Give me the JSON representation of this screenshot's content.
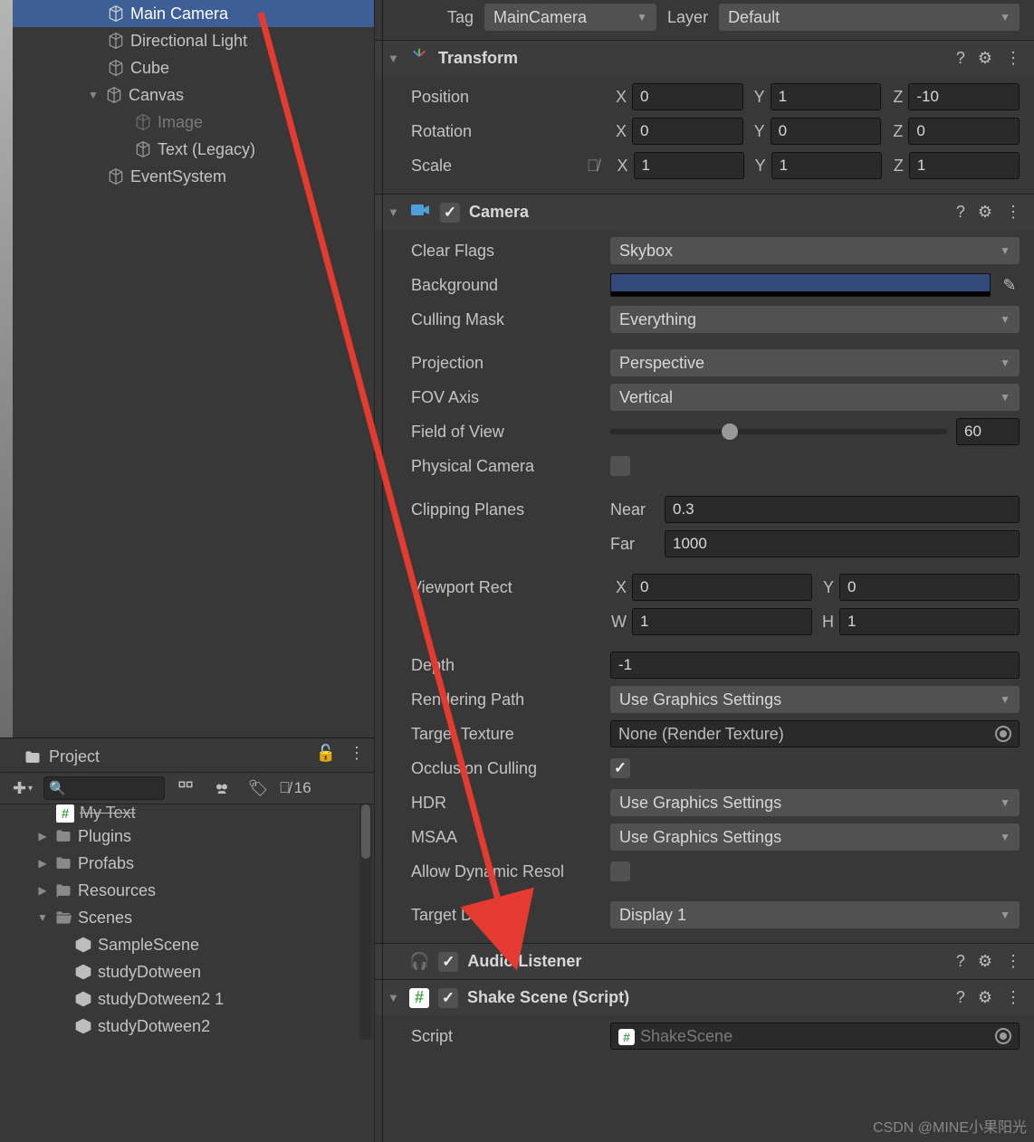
{
  "hierarchy": {
    "items": [
      {
        "label": "Main Camera",
        "indent": 1,
        "selected": true
      },
      {
        "label": "Directional Light",
        "indent": 1
      },
      {
        "label": "Cube",
        "indent": 1
      },
      {
        "label": "Canvas",
        "indent": 1,
        "fold": "down"
      },
      {
        "label": "Image",
        "indent": 2,
        "dimmed": true
      },
      {
        "label": "Text (Legacy)",
        "indent": 2
      },
      {
        "label": "EventSystem",
        "indent": 1
      }
    ]
  },
  "project": {
    "tab": "Project",
    "search_placeholder": "",
    "hidden_count": "16",
    "tree": [
      {
        "label": "My Text",
        "indent": 62,
        "type": "script-green",
        "clipped": true
      },
      {
        "label": "Plugins",
        "indent": 40,
        "type": "folder",
        "arrow": "right"
      },
      {
        "label": "Profabs",
        "indent": 40,
        "type": "folder",
        "arrow": "right"
      },
      {
        "label": "Resources",
        "indent": 40,
        "type": "folder",
        "arrow": "right"
      },
      {
        "label": "Scenes",
        "indent": 40,
        "type": "folder-open",
        "arrow": "down"
      },
      {
        "label": "SampleScene",
        "indent": 82,
        "type": "unity"
      },
      {
        "label": "studyDotween",
        "indent": 82,
        "type": "unity"
      },
      {
        "label": "studyDotween2 1",
        "indent": 82,
        "type": "unity"
      },
      {
        "label": "studyDotween2",
        "indent": 82,
        "type": "unity"
      }
    ]
  },
  "inspector": {
    "tag_label": "Tag",
    "tag_value": "MainCamera",
    "layer_label": "Layer",
    "layer_value": "Default",
    "transform": {
      "title": "Transform",
      "position": {
        "label": "Position",
        "x": "0",
        "y": "1",
        "z": "-10"
      },
      "rotation": {
        "label": "Rotation",
        "x": "0",
        "y": "0",
        "z": "0"
      },
      "scale": {
        "label": "Scale",
        "x": "1",
        "y": "1",
        "z": "1"
      }
    },
    "camera": {
      "title": "Camera",
      "clear_flags": {
        "label": "Clear Flags",
        "value": "Skybox"
      },
      "background_label": "Background",
      "culling_mask": {
        "label": "Culling Mask",
        "value": "Everything"
      },
      "projection": {
        "label": "Projection",
        "value": "Perspective"
      },
      "fov_axis": {
        "label": "FOV Axis",
        "value": "Vertical"
      },
      "fov": {
        "label": "Field of View",
        "value": "60"
      },
      "physical": {
        "label": "Physical Camera",
        "checked": false
      },
      "clipping": {
        "label": "Clipping Planes",
        "near_label": "Near",
        "near": "0.3",
        "far_label": "Far",
        "far": "1000"
      },
      "viewport": {
        "label": "Viewport Rect",
        "x": "0",
        "y": "0",
        "w": "1",
        "h": "1"
      },
      "depth": {
        "label": "Depth",
        "value": "-1"
      },
      "rendering_path": {
        "label": "Rendering Path",
        "value": "Use Graphics Settings"
      },
      "target_texture": {
        "label": "Target Texture",
        "value": "None (Render Texture)"
      },
      "occlusion": {
        "label": "Occlusion Culling",
        "checked": true
      },
      "hdr": {
        "label": "HDR",
        "value": "Use Graphics Settings"
      },
      "msaa": {
        "label": "MSAA",
        "value": "Use Graphics Settings"
      },
      "dyn_resol": {
        "label": "Allow Dynamic Resol",
        "checked": false
      },
      "target_display": {
        "label": "Target Display",
        "value": "Display 1"
      }
    },
    "audio_listener": {
      "title": "Audio Listener",
      "checked": true
    },
    "shake_scene": {
      "title": "Shake Scene (Script)",
      "checked": true,
      "script_label": "Script",
      "script_value": "ShakeScene"
    }
  },
  "axis": {
    "x": "X",
    "y": "Y",
    "z": "Z",
    "w": "W",
    "h": "H"
  },
  "watermark": "CSDN @MINE小果阳光"
}
